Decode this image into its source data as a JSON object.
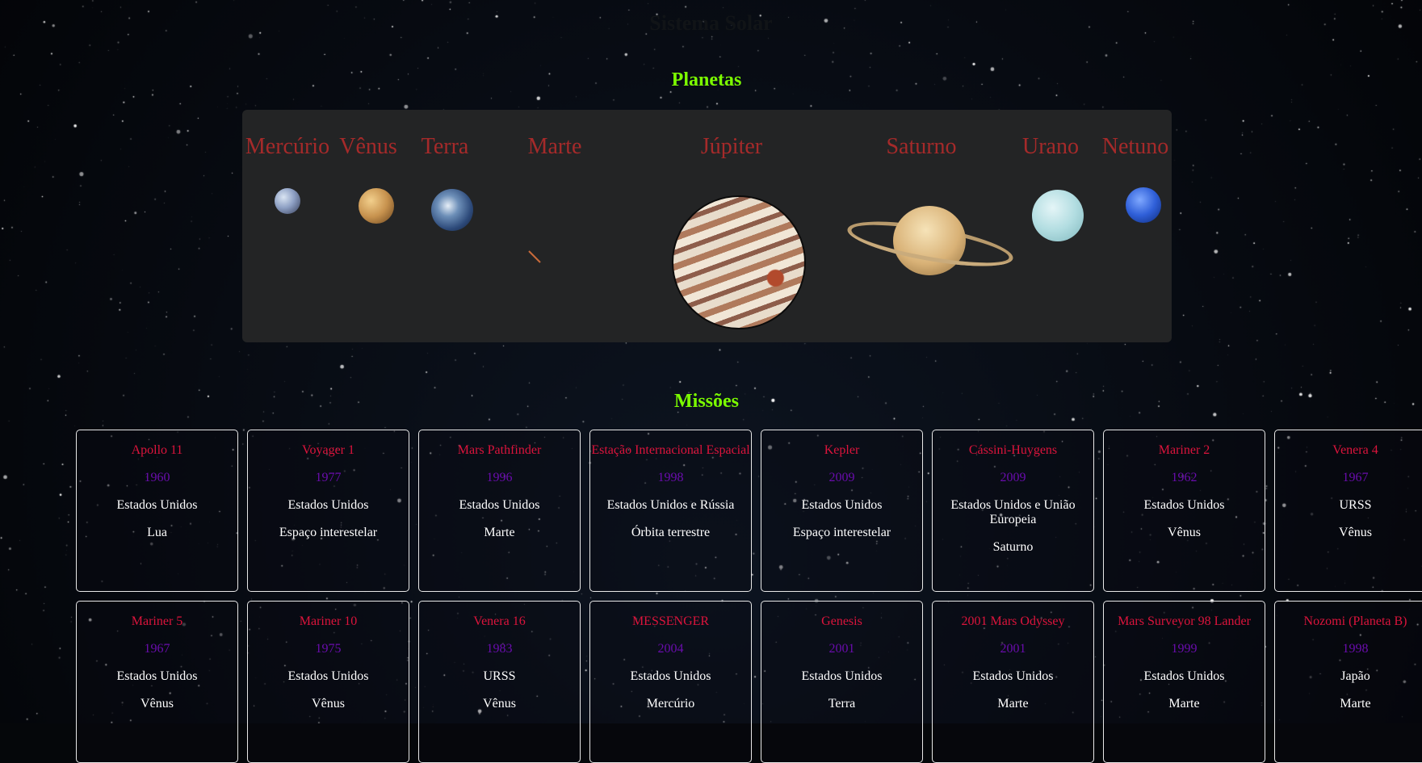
{
  "header": {
    "title": "Sistema Solar"
  },
  "planets_section": {
    "title": "Planetas",
    "planets": [
      "Mercúrio",
      "Vênus",
      "Terra",
      "Marte",
      "Júpiter",
      "Saturno",
      "Urano",
      "Netuno"
    ]
  },
  "missions_section": {
    "title": "Missões",
    "missions": [
      {
        "name": "Apollo 11",
        "year": "1960",
        "country": "Estados Unidos",
        "target": "Lua"
      },
      {
        "name": "Voyager 1",
        "year": "1977",
        "country": "Estados Unidos",
        "target": "Espaço interestelar"
      },
      {
        "name": "Mars Pathfinder",
        "year": "1996",
        "country": "Estados Unidos",
        "target": "Marte"
      },
      {
        "name": "Estação Internacional Espacial",
        "year": "1998",
        "country": "Estados Unidos e Rússia",
        "target": "Órbita terrestre"
      },
      {
        "name": "Kepler",
        "year": "2009",
        "country": "Estados Unidos",
        "target": "Espaço interestelar"
      },
      {
        "name": "Cássini-Huygens",
        "year": "2009",
        "country": "Estados Unidos e União Europeia",
        "target": "Saturno"
      },
      {
        "name": "Mariner 2",
        "year": "1962",
        "country": "Estados Unidos",
        "target": "Vênus"
      },
      {
        "name": "Venera 4",
        "year": "1967",
        "country": "URSS",
        "target": "Vênus"
      },
      {
        "name": "Mariner 5",
        "year": "1967",
        "country": "Estados Unidos",
        "target": "Vênus"
      },
      {
        "name": "Mariner 10",
        "year": "1975",
        "country": "Estados Unidos",
        "target": "Vênus"
      },
      {
        "name": "Venera 16",
        "year": "1983",
        "country": "URSS",
        "target": "Vênus"
      },
      {
        "name": "MESSENGER",
        "year": "2004",
        "country": "Estados Unidos",
        "target": "Mercúrio"
      },
      {
        "name": "Genesis",
        "year": "2001",
        "country": "Estados Unidos",
        "target": "Terra"
      },
      {
        "name": "2001 Mars Odyssey",
        "year": "2001",
        "country": "Estados Unidos",
        "target": "Marte"
      },
      {
        "name": "Mars Surveyor 98 Lander",
        "year": "1999",
        "country": "Estados Unidos",
        "target": "Marte"
      },
      {
        "name": "Nozomi (Planeta B)",
        "year": "1998",
        "country": "Japão",
        "target": "Marte"
      }
    ]
  },
  "colors": {
    "section_title": "#7cfc00",
    "planet_name": "#a52a2a",
    "mission_name": "#dc143c",
    "mission_year": "#6a0dad",
    "mission_text": "#ffffff"
  }
}
